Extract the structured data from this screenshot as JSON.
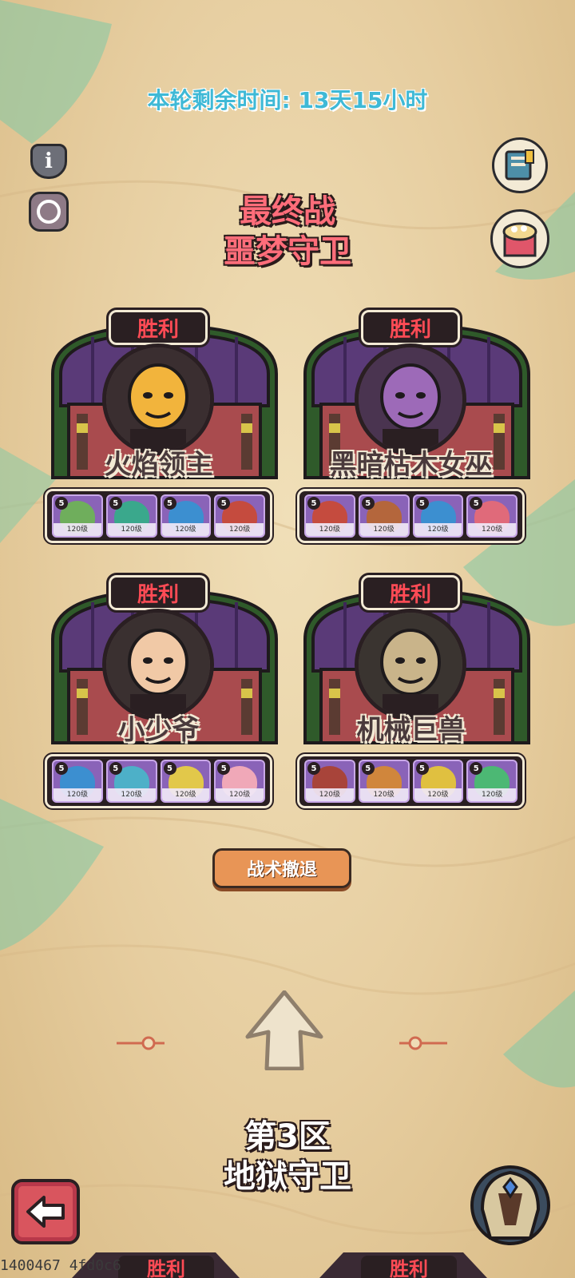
{
  "header": {
    "timer_label": "本轮剩余时间:",
    "timer_value": "13天15小时"
  },
  "final_battle": {
    "line1": "最终战",
    "line2": "噩梦守卫"
  },
  "bosses": [
    {
      "status": "胜利",
      "name": "火焰领主",
      "team": [
        {
          "star": "5",
          "level": "120级",
          "color": "#6fae5c"
        },
        {
          "star": "5",
          "level": "120级",
          "color": "#3aa88c"
        },
        {
          "star": "5",
          "level": "120级",
          "color": "#3c8fd0"
        },
        {
          "star": "5",
          "level": "120级",
          "color": "#c54b3e"
        }
      ]
    },
    {
      "status": "胜利",
      "name": "黑暗枯木女巫",
      "team": [
        {
          "star": "5",
          "level": "120级",
          "color": "#c54b3e"
        },
        {
          "star": "5",
          "level": "120级",
          "color": "#b4663c"
        },
        {
          "star": "5",
          "level": "120级",
          "color": "#3c8fd0"
        },
        {
          "star": "5",
          "level": "120级",
          "color": "#e06a7a"
        }
      ]
    },
    {
      "status": "胜利",
      "name": "小少爷",
      "team": [
        {
          "star": "5",
          "level": "120级",
          "color": "#3c8fd0"
        },
        {
          "star": "5",
          "level": "120级",
          "color": "#4db0c8"
        },
        {
          "star": "5",
          "level": "120级",
          "color": "#e2c84a"
        },
        {
          "star": "5",
          "level": "120级",
          "color": "#f0a8b8"
        }
      ]
    },
    {
      "status": "胜利",
      "name": "机械巨兽",
      "team": [
        {
          "star": "5",
          "level": "120级",
          "color": "#a8443a"
        },
        {
          "star": "5",
          "level": "120级",
          "color": "#d0863c"
        },
        {
          "star": "5",
          "level": "120级",
          "color": "#e0c040"
        },
        {
          "star": "5",
          "level": "120级",
          "color": "#4cb874"
        }
      ]
    }
  ],
  "actions": {
    "retreat_label": "战术撤退"
  },
  "zone": {
    "line1": "第3区",
    "line2": "地狱守卫"
  },
  "bottom": {
    "peek_left": "胜利",
    "peek_right": "胜利",
    "build_id": "1400467 4fd0c6"
  },
  "icons": {
    "info": "info-icon",
    "cycle": "cycle-icon",
    "book": "book-icon",
    "gift": "gift-box-icon",
    "back": "back-arrow-icon",
    "helm": "helmet-icon",
    "up_arrow": "up-arrow-icon"
  },
  "colors": {
    "timer": "#3fb9d6",
    "final_title": "#ff6d7a",
    "victory": "#ff4b55",
    "retreat": "#e89556",
    "hut_roof": "#5a3a78"
  }
}
